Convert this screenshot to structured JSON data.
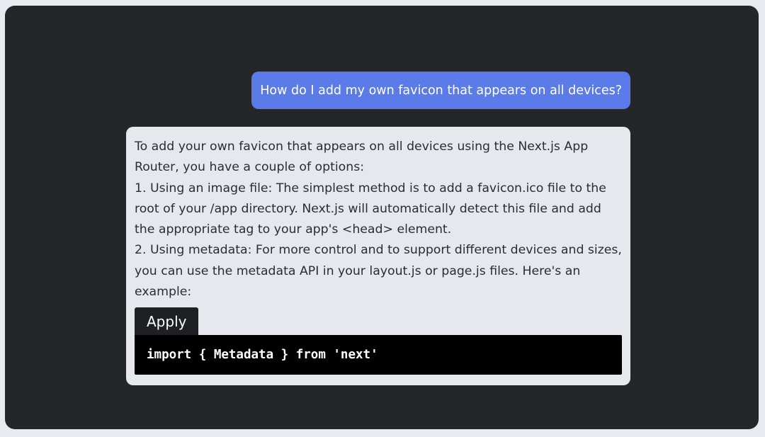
{
  "conversation": {
    "user_message": "How do I add my own favicon that appears on all devices?",
    "assistant_message": {
      "paragraphs": [
        "To add your own favicon that appears on all devices using the Next.js App Router, you have a couple of options:",
        "1. Using an image file: The simplest method is to add a favicon.ico file to the root of your /app directory. Next.js will automatically detect this file and add the appropriate tag to your app's <head> element.",
        "2. Using metadata: For more control and to support different devices and sizes, you can use the metadata API in your layout.js or page.js files. Here's an example:"
      ],
      "code_block": {
        "tab_label": "Apply",
        "code": "import { Metadata } from 'next'"
      }
    }
  },
  "colors": {
    "page_background": "#e8eaf0",
    "frame_background": "#25262a",
    "user_bubble": "#5b7be8",
    "assistant_bubble": "#e6e8ee",
    "code_background": "#000000"
  }
}
